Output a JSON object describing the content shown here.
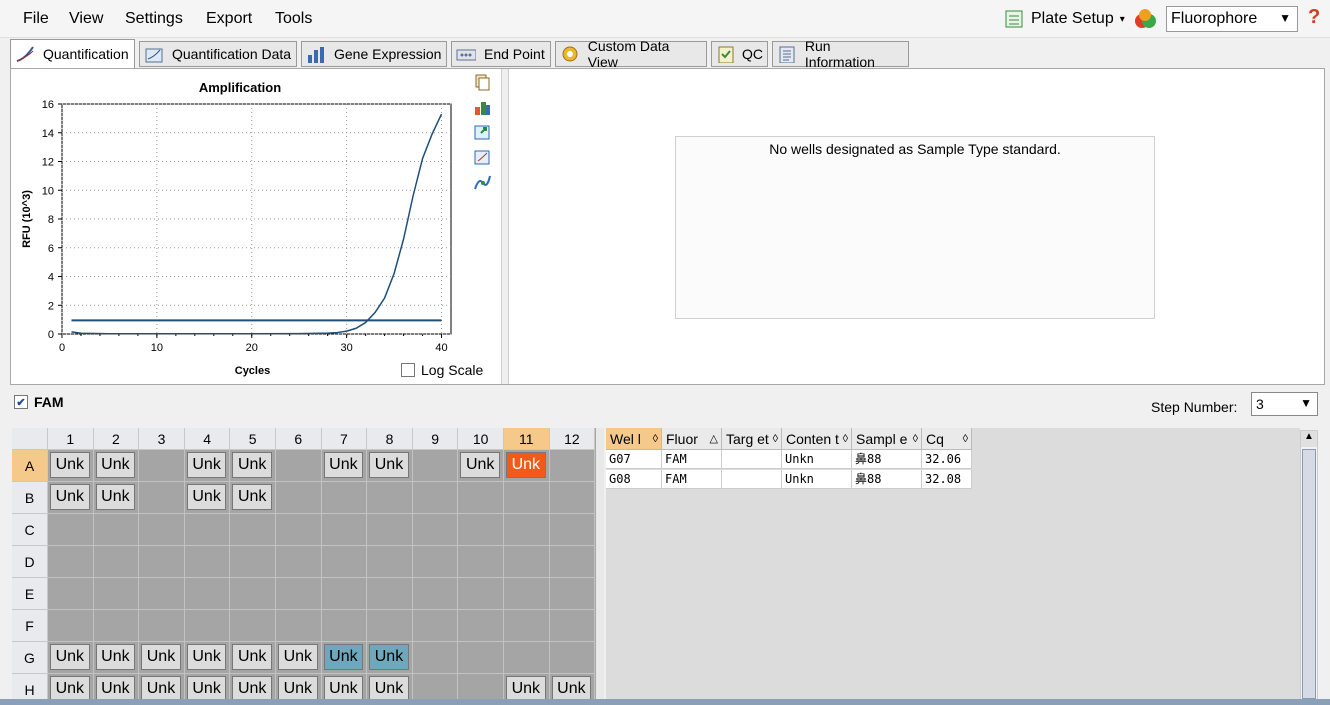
{
  "menu": [
    "File",
    "View",
    "Settings",
    "Export",
    "Tools"
  ],
  "plate_setup_label": "Plate Setup",
  "fluorophore_select": "Fluorophore",
  "help_label": "?",
  "tabs": [
    {
      "label": "Quantification",
      "active": true,
      "icon": "quantification-icon"
    },
    {
      "label": "Quantification Data",
      "icon": "quant-data-icon"
    },
    {
      "label": "Gene Expression",
      "icon": "gene-expression-icon"
    },
    {
      "label": "End Point",
      "icon": "end-point-icon"
    },
    {
      "label": "Custom Data View",
      "icon": "gear-icon"
    },
    {
      "label": "QC",
      "icon": "qc-icon"
    },
    {
      "label": "Run Information",
      "icon": "run-info-icon"
    }
  ],
  "chart_data": {
    "type": "line",
    "title": "Amplification",
    "xlabel": "Cycles",
    "ylabel": "RFU (10^3)",
    "xlim": [
      0,
      41
    ],
    "ylim": [
      0,
      16
    ],
    "xticks": [
      0,
      10,
      20,
      30,
      40
    ],
    "yticks": [
      0,
      2,
      4,
      6,
      8,
      10,
      12,
      14,
      16
    ],
    "grid": true,
    "series": [
      {
        "values_x": [
          1,
          2,
          5,
          10,
          15,
          20,
          25,
          28,
          29,
          30,
          31,
          32,
          33,
          34,
          35,
          36,
          37,
          38,
          39,
          40
        ],
        "values_y": [
          0.15,
          0.05,
          0.02,
          0.02,
          0.02,
          0.02,
          0.03,
          0.06,
          0.1,
          0.2,
          0.4,
          0.8,
          1.5,
          2.5,
          4.2,
          6.6,
          9.6,
          12.2,
          13.9,
          15.3
        ]
      },
      {
        "values_x": [
          1,
          40
        ],
        "values_y": [
          0.95,
          0.95
        ]
      }
    ],
    "line_color": "#1f4e79"
  },
  "log_scale_label": "Log Scale",
  "standard_message": "No wells designated as Sample Type standard.",
  "fam_label": "FAM",
  "step_label": "Step Number:",
  "step_value": "3",
  "plate": {
    "cols": [
      "1",
      "2",
      "3",
      "4",
      "5",
      "6",
      "7",
      "8",
      "9",
      "10",
      "11",
      "12"
    ],
    "rows": [
      "A",
      "B",
      "C",
      "D",
      "E",
      "F",
      "G",
      "H"
    ],
    "highlight_row": "A",
    "highlight_col": "11",
    "wells": [
      [
        "Unk",
        "Unk",
        "",
        "Unk",
        "Unk",
        "",
        "Unk",
        "Unk",
        "",
        "Unk",
        "Unk",
        ""
      ],
      [
        "Unk",
        "Unk",
        "",
        "Unk",
        "Unk",
        "",
        "",
        "",
        "",
        "",
        "",
        ""
      ],
      [
        "",
        "",
        "",
        "",
        "",
        "",
        "",
        "",
        "",
        "",
        "",
        ""
      ],
      [
        "",
        "",
        "",
        "",
        "",
        "",
        "",
        "",
        "",
        "",
        "",
        ""
      ],
      [
        "",
        "",
        "",
        "",
        "",
        "",
        "",
        "",
        "",
        "",
        "",
        ""
      ],
      [
        "",
        "",
        "",
        "",
        "",
        "",
        "",
        "",
        "",
        "",
        "",
        ""
      ],
      [
        "Unk",
        "Unk",
        "Unk",
        "Unk",
        "Unk",
        "Unk",
        "Unk",
        "Unk",
        "",
        "",
        "",
        ""
      ],
      [
        "Unk",
        "Unk",
        "Unk",
        "Unk",
        "Unk",
        "Unk",
        "Unk",
        "Unk",
        "",
        "",
        "Unk",
        "Unk"
      ]
    ]
  },
  "table": {
    "headers": [
      "Wel l",
      "Fluor",
      "Targ et",
      "Conten t",
      "Sampl e",
      "Cq"
    ],
    "rows": [
      [
        "G07",
        "FAM",
        "",
        "Unkn",
        "鼻88",
        "32.06"
      ],
      [
        "G08",
        "FAM",
        "",
        "Unkn",
        "鼻88",
        "32.08"
      ]
    ]
  }
}
